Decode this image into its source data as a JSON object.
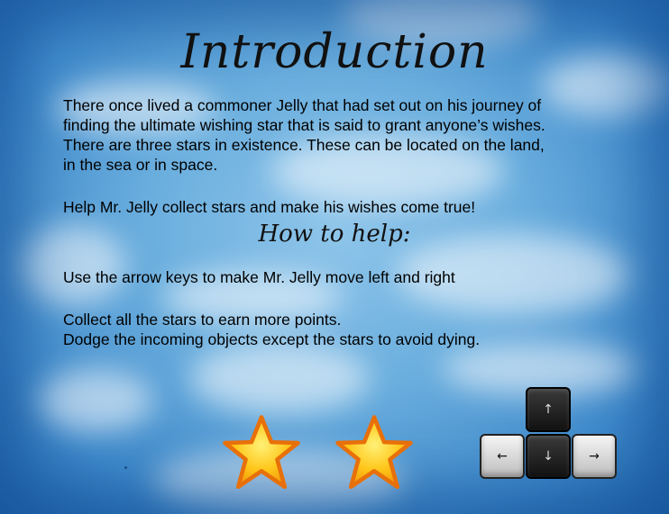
{
  "screen": {
    "title": "Introduction",
    "intro_paragraph": "There once lived a commoner Jelly that had set out on his journey of finding the ultimate wishing star that is said to grant anyone’s wishes. There are three stars in existence. These can be located on the land, in the sea or in space.",
    "intro_line1": "There once lived a commoner Jelly that had set out on his journey of",
    "intro_line2": "finding the ultimate wishing star that is said to grant anyone’s wishes.",
    "intro_line3": "There are three stars in existence. These can be located on the land,",
    "intro_line4": "in the sea or in space.",
    "call_to_action": "Help Mr. Jelly collect stars and make his wishes come true!",
    "help_heading": "How to help:",
    "instruction_move": "Use the arrow keys to make Mr. Jelly move left and right",
    "instruction_collect": "Collect all the stars to earn more points.",
    "instruction_dodge": "Dodge the incoming objects except the stars to avoid dying."
  },
  "keys": {
    "up": "↑",
    "left": "←",
    "down": "↓",
    "right": "→"
  },
  "icons": [
    "star-icon",
    "star-icon",
    "arrow-keys-icon"
  ],
  "colors": {
    "sky": "#6aaede",
    "star_fill": "#ffcc22",
    "star_stroke": "#e8700a"
  }
}
